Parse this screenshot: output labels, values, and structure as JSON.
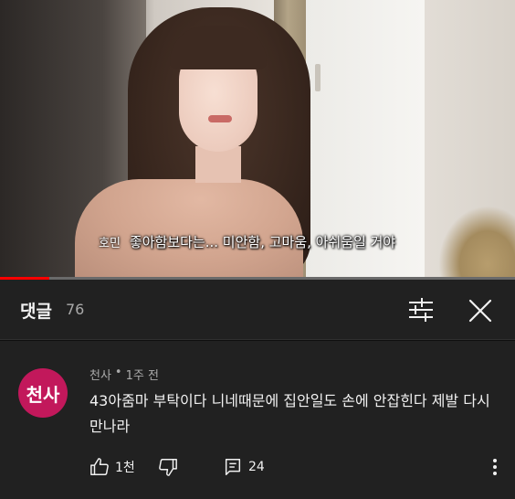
{
  "video": {
    "caption_speaker": "호민",
    "caption_text": "좋아함보다는... 미안함, 고마움, 아쉬움일 거야",
    "progress_fraction": 0.095,
    "progress_color": "#ff0000"
  },
  "comments_panel": {
    "title": "댓글",
    "count": "76",
    "sort_icon": "sliders-icon",
    "close_icon": "close-icon"
  },
  "comment": {
    "avatar_text": "천사",
    "avatar_color": "#c2185b",
    "author": "천사",
    "separator": "•",
    "time": "1주 전",
    "text": "43아줌마 부탁이다 니네때문에 집안일도 손에 안잡힌다  제발 다시 만나라",
    "like_count": "1천",
    "reply_count": "24",
    "like_icon": "thumbs-up-icon",
    "dislike_icon": "thumbs-down-icon",
    "reply_icon": "reply-icon",
    "more_icon": "more-vertical-icon"
  }
}
